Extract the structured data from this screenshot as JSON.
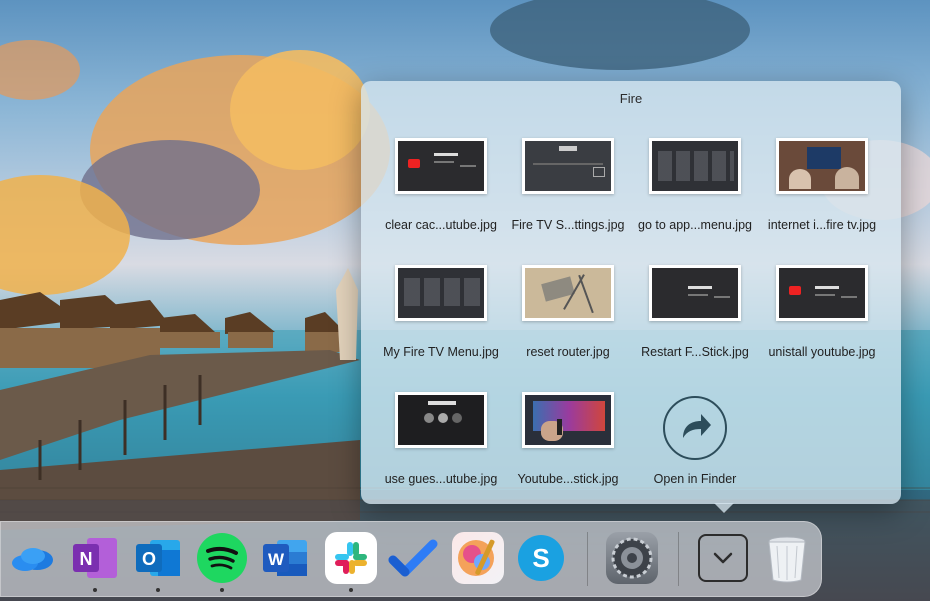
{
  "stack": {
    "title": "Fire",
    "items": [
      {
        "label": "clear cac...utube.jpg"
      },
      {
        "label": "Fire TV S...ttings.jpg"
      },
      {
        "label": "go to app...menu.jpg"
      },
      {
        "label": "internet i...fire tv.jpg"
      },
      {
        "label": "My Fire TV Menu.jpg"
      },
      {
        "label": "reset router.jpg"
      },
      {
        "label": "Restart F...Stick.jpg"
      },
      {
        "label": "unistall youtube.jpg"
      },
      {
        "label": "use gues...utube.jpg"
      },
      {
        "label": "Youtube...stick.jpg"
      }
    ],
    "open_in_finder_label": "Open in Finder"
  },
  "dock": {
    "apps": [
      {
        "name": "OneDrive",
        "icon": "onedrive-icon",
        "running": false
      },
      {
        "name": "OneNote",
        "icon": "onenote-icon",
        "running": true
      },
      {
        "name": "Outlook",
        "icon": "outlook-icon",
        "running": true
      },
      {
        "name": "Spotify",
        "icon": "spotify-icon",
        "running": true
      },
      {
        "name": "Word",
        "icon": "word-icon",
        "running": false
      },
      {
        "name": "Slack",
        "icon": "slack-icon",
        "running": true
      },
      {
        "name": "To Do",
        "icon": "todo-icon",
        "running": false
      },
      {
        "name": "Pixelmator",
        "icon": "pixelmator-icon",
        "running": false
      },
      {
        "name": "Skype",
        "icon": "skype-icon",
        "running": false
      },
      {
        "name": "System Preferences",
        "icon": "system-preferences-icon",
        "running": false
      },
      {
        "name": "Downloads Stack",
        "icon": "chevron-down-icon",
        "running": false
      },
      {
        "name": "Trash",
        "icon": "trash-icon",
        "running": false
      }
    ],
    "letters": {
      "onenote": "N",
      "outlook": "O",
      "word": "W",
      "skype": "S"
    }
  },
  "colors": {
    "onenote": "#7b2fb0",
    "outlook": "#0f6cbd",
    "spotify": "#1ed760",
    "word": "#1f5bbf",
    "skype": "#1aa1e1",
    "todo": "#2e7cf6"
  }
}
